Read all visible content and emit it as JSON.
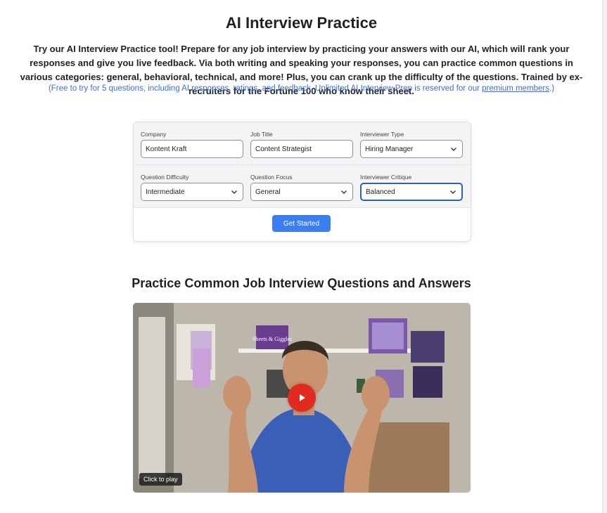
{
  "page": {
    "title": "AI Interview Practice",
    "intro": "Try our AI Interview Practice tool! Prepare for any job interview by practicing your answers with our AI, which will rank your responses and give you live feedback. Via both writing and speaking your responses, you can practice common questions in various categories: general, behavioral, technical, and more! Plus, you can crank up the difficulty of the questions. Trained by ex-recruiters for the Fortune 100 who know their sheet.",
    "note_prefix": "(Free to try for 5 questions, including AI responses, ratings, and feedback. Unlimited AI Interview Prep is reserved for our ",
    "note_link": "premium members",
    "note_suffix": ".)"
  },
  "form": {
    "company": {
      "label": "Company",
      "value": "Kontent Kraft"
    },
    "job_title": {
      "label": "Job Title",
      "value": "Content Strategist"
    },
    "interviewer_type": {
      "label": "Interviewer Type",
      "value": "Hiring Manager"
    },
    "question_difficulty": {
      "label": "Question Difficulty",
      "value": "Intermediate"
    },
    "question_focus": {
      "label": "Question Focus",
      "value": "General"
    },
    "interviewer_critique": {
      "label": "Interviewer Critique",
      "value": "Balanced"
    },
    "submit_label": "Get Started"
  },
  "video_section": {
    "title": "Practice Common Job Interview Questions and Answers",
    "click_to_play": "Click to play",
    "canvas_text": "Sheets & Giggles"
  },
  "colors": {
    "accent": "#3b7ef2",
    "link": "#3d6fd6",
    "play_button": "#e22b1f"
  },
  "icons": [
    "chevron-down-icon",
    "play-icon"
  ]
}
